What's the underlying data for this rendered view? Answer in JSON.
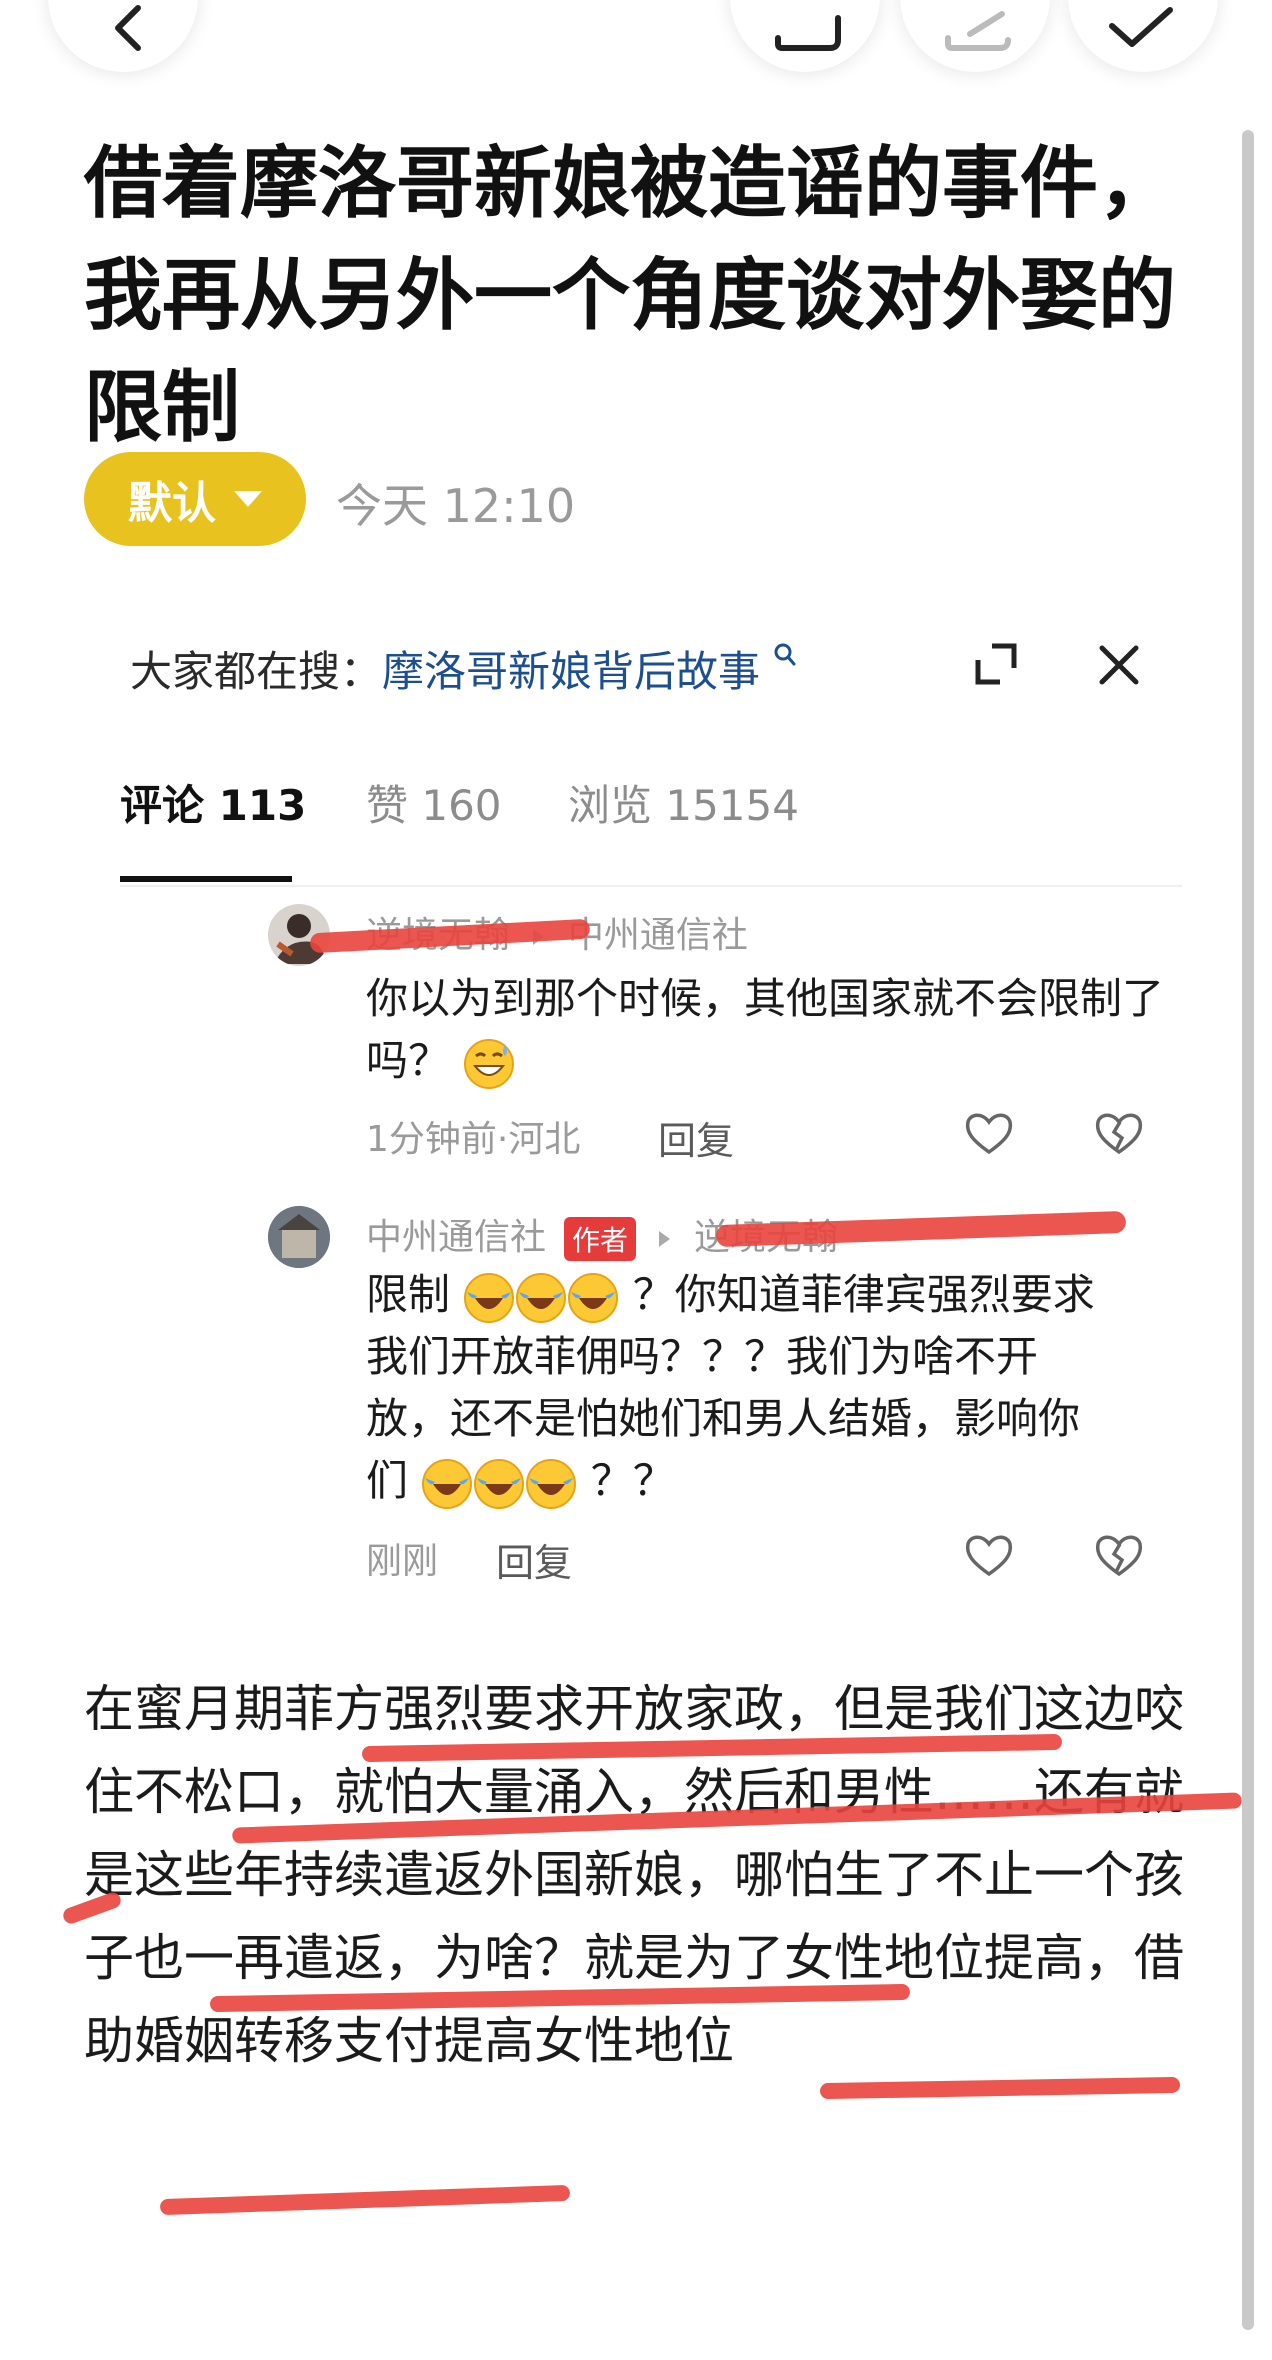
{
  "top_bar": {
    "back_icon": "chevron-left-icon",
    "share_icon": "share-icon",
    "edit_icon": "edit-icon",
    "confirm_icon": "check-icon"
  },
  "article": {
    "title": "借着摩洛哥新娘被造谣的事件，我再从另外一个角度谈对外娶的限制",
    "sort_label": "默认",
    "time": "今天 12:10"
  },
  "search_suggest": {
    "prefix": "大家都在搜：",
    "keyword": "摩洛哥新娘背后故事"
  },
  "tabs": [
    {
      "label": "评论 113"
    },
    {
      "label": "赞 160"
    },
    {
      "label": "浏览 15154"
    }
  ],
  "comments": [
    {
      "user": "逆境无翰",
      "reply_to": "中州通信社",
      "text": "你以为到那个时候，其他国家就不会限制了吗？",
      "meta": "1分钟前·河北",
      "reply_label": "回复"
    },
    {
      "user": "中州通信社",
      "badge": "作者",
      "reply_to": "逆境无翰",
      "text_line1_prefix": "限制",
      "text_line1_suffix": "？你知道菲律宾强烈要求",
      "text_line2": "我们开放菲佣吗？？？我们为啥不开",
      "text_line3": "放，还不是怕她们和男人结婚，影响你",
      "text_line4_prefix": "们",
      "text_line4_suffix": "？？",
      "meta": "刚刚",
      "reply_label": "回复"
    }
  ],
  "caption": "在蜜月期菲方强烈要求开放家政，但是我们这边咬住不松口，就怕大量涌入，然后和男性……还有就是这些年持续遣返外国新娘，哪怕生了不止一个孩子也一再遣返，为啥？就是为了女性地位提高，借助婚姻转移支付提高女性地位",
  "colors": {
    "accent_yellow": "#e8c21e",
    "link_blue": "#1d4f8f",
    "author_badge_red": "#e53b3b",
    "annotation_red": "#e9453d"
  }
}
